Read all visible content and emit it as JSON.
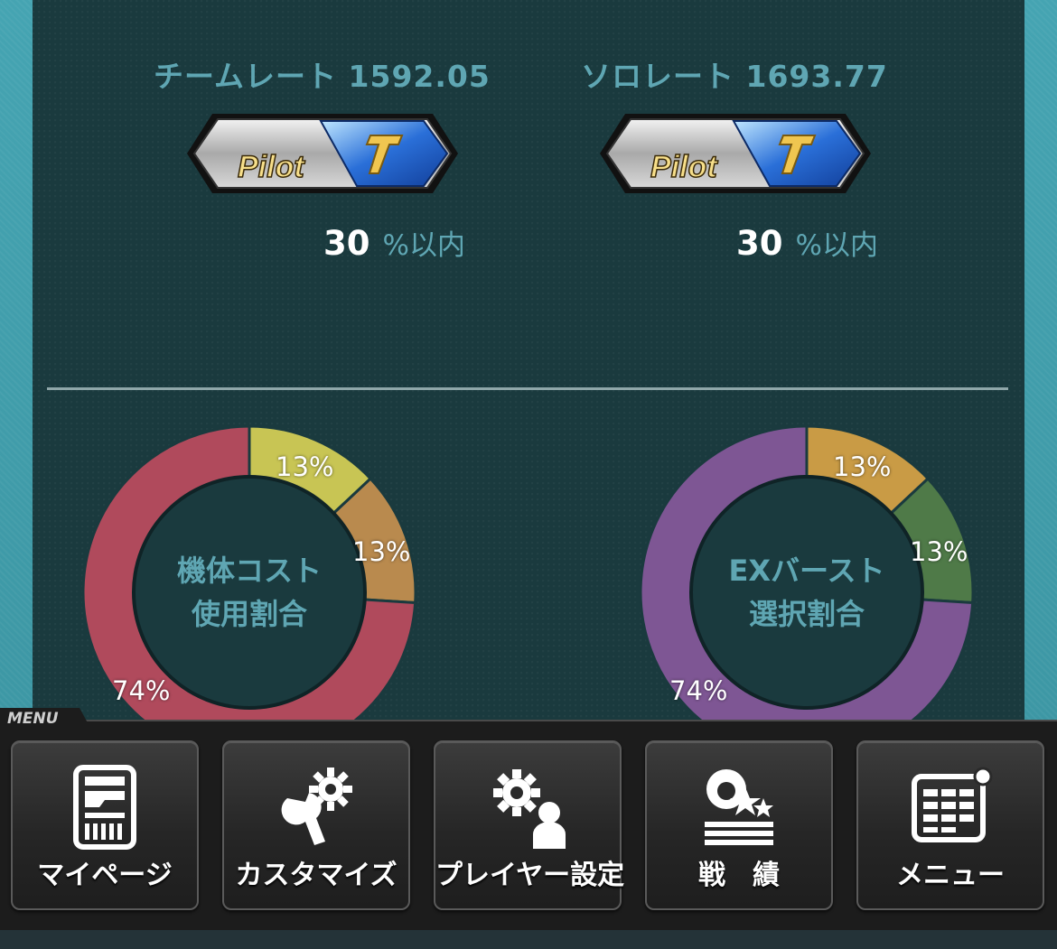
{
  "ratings": {
    "team": {
      "label": "チームレート",
      "value": "1592.05",
      "badge_text": "Pilot",
      "percentile": "30",
      "percentile_unit": "%以内"
    },
    "solo": {
      "label": "ソロレート",
      "value": "1693.77",
      "badge_text": "Pilot",
      "percentile": "30",
      "percentile_unit": "%以内"
    }
  },
  "charts": {
    "cost": {
      "label_line1": "機体コスト",
      "label_line2": "使用割合",
      "segments": [
        {
          "value": 13,
          "label": "13%",
          "color": "#c8c554"
        },
        {
          "value": 13,
          "label": "13%",
          "color": "#b98a4e"
        },
        {
          "value": 74,
          "label": "74%",
          "color": "#b04a5c"
        }
      ]
    },
    "burst": {
      "label_line1": "EXバースト",
      "label_line2": "選択割合",
      "segments": [
        {
          "value": 13,
          "label": "13%",
          "color": "#c99b45"
        },
        {
          "value": 13,
          "label": "13%",
          "color": "#4f7a48"
        },
        {
          "value": 74,
          "label": "74%",
          "color": "#7e5694"
        }
      ]
    }
  },
  "menu": {
    "tag": "MENU",
    "items": [
      {
        "label": "マイページ",
        "icon": "mypage-icon"
      },
      {
        "label": "カスタマイズ",
        "icon": "customize-icon"
      },
      {
        "label": "プレイヤー設定",
        "icon": "player-settings-icon"
      },
      {
        "label": "戦　績",
        "icon": "record-icon"
      },
      {
        "label": "メニュー",
        "icon": "menu-grid-icon"
      }
    ]
  },
  "colors": {
    "panel": "#1a3a3e",
    "accent_text": "#5fa6b3",
    "side": "#3f9aa8"
  }
}
